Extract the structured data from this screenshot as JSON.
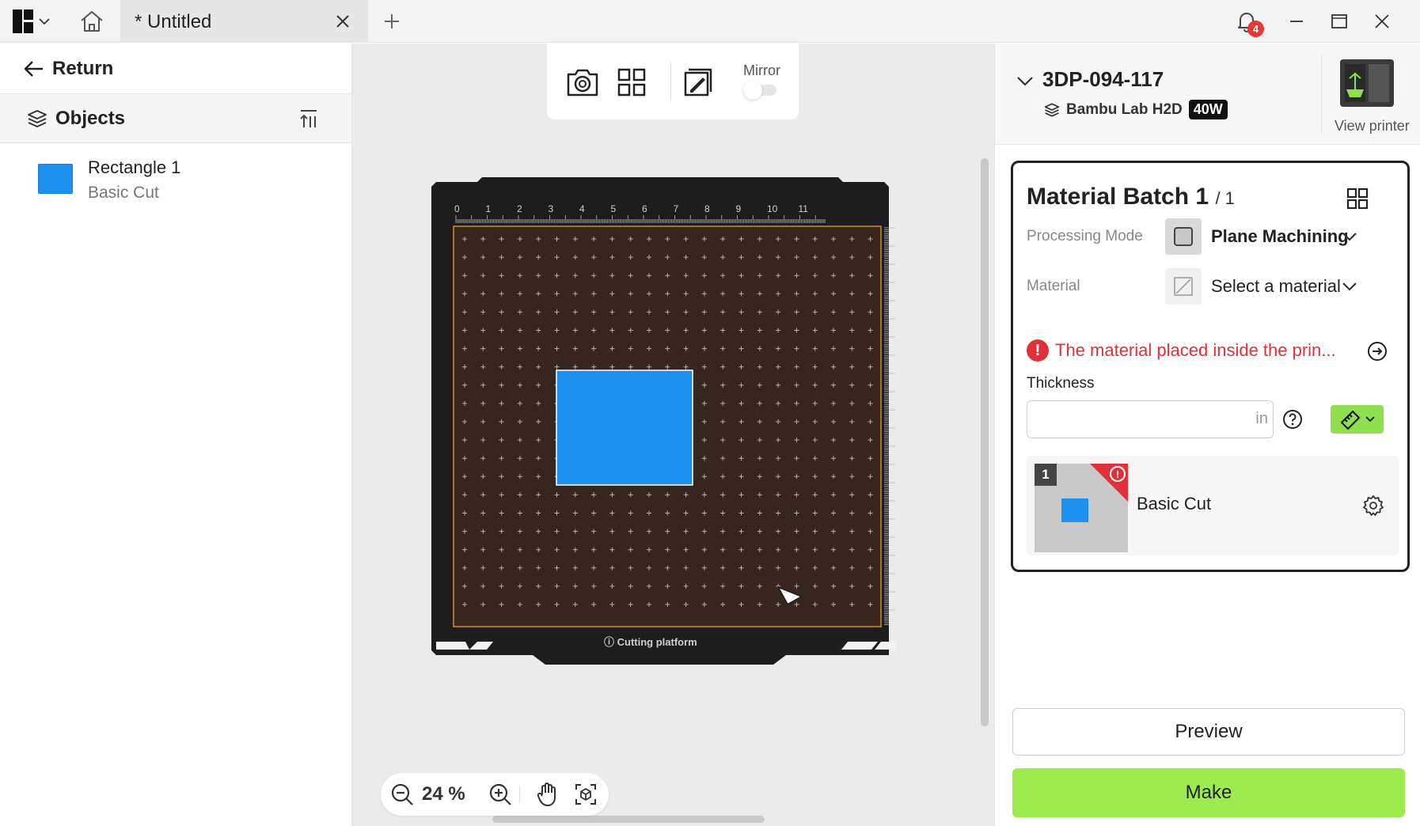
{
  "window": {
    "tab_title": "* Untitled",
    "notification_count": "4",
    "icons": [
      "app-logo-icon",
      "home-icon",
      "close-icon",
      "plus-icon",
      "bell-icon",
      "minimize-icon",
      "maximize-icon",
      "window-close-icon"
    ]
  },
  "left_panel": {
    "return_label": "Return",
    "objects_label": "Objects",
    "objects": [
      {
        "name": "Rectangle 1",
        "mode": "Basic Cut",
        "color": "#1e90f0"
      }
    ]
  },
  "canvas": {
    "toolbar": {
      "mirror_label": "Mirror",
      "mirror_on": false
    },
    "platform_label": "Cutting platform",
    "ruler_ticks": [
      "0",
      "1",
      "2",
      "3",
      "4",
      "5",
      "6",
      "7",
      "8",
      "9",
      "10",
      "11"
    ],
    "zoom_label": "24 %",
    "object_color": "#1e90f0"
  },
  "right_panel": {
    "printer_name": "3DP-094-117",
    "printer_model": "Bambu Lab H2D",
    "power_badge": "40W",
    "view_printer_label": "View printer",
    "batch": {
      "title": "Material Batch 1",
      "count": "/ 1",
      "processing_mode_label": "Processing Mode",
      "processing_mode_value": "Plane Machining",
      "material_label": "Material",
      "material_value": "Select a material",
      "warning_text": "The material placed inside the prin...",
      "thickness_label": "Thickness",
      "thickness_value": "",
      "thickness_unit": "in",
      "job": {
        "number": "1",
        "name": "Basic Cut"
      }
    },
    "preview_label": "Preview",
    "make_label": "Make",
    "colors": {
      "accent_green": "#9ceb4e",
      "warning_red": "#e0303a"
    }
  }
}
